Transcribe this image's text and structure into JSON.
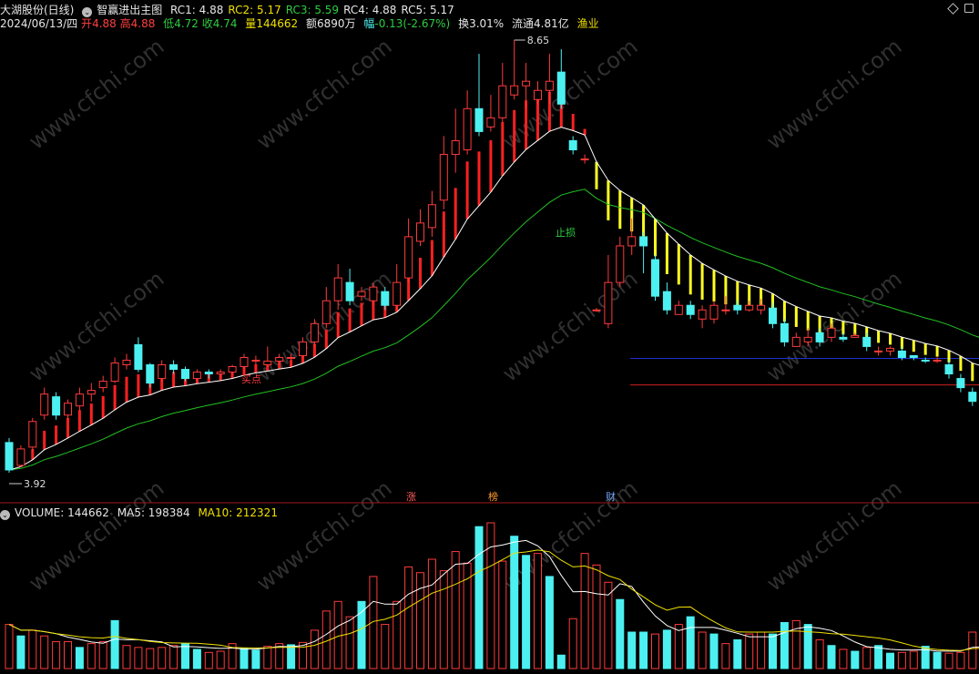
{
  "header": {
    "title": "大湖股份(日线)",
    "indicator_name": "智赢进出主图",
    "rc": [
      {
        "label": "RC1: 4.88",
        "color": "#e6e6e6"
      },
      {
        "label": "RC2: 5.17",
        "color": "#f0e000"
      },
      {
        "label": "RC3: 5.59",
        "color": "#2ecc40"
      },
      {
        "label": "RC4: 4.88",
        "color": "#e6e6e6"
      },
      {
        "label": "RC5: 5.17",
        "color": "#e6e6e6"
      }
    ]
  },
  "quote": {
    "date": "2024/06/13/四",
    "open_label": "开",
    "open": "4.88",
    "high_label": "高",
    "high": "4.88",
    "low_label": "低",
    "low": "4.72",
    "close_label": "收",
    "close": "4.74",
    "volume_label": "量",
    "volume": "144662",
    "amount_label": "额",
    "amount": "6890万",
    "change_label": "幅",
    "change": "-0.13(-2.67%)",
    "turnover": "换3.01%",
    "float_cap": "流通4.81亿",
    "sector": "渔业"
  },
  "volume_header": {
    "volume": "VOLUME: 144662",
    "ma5": "MA5: 198384",
    "ma10": "MA10: 212321"
  },
  "markers": {
    "zhang": "涨",
    "bang": "榜",
    "cai": "财",
    "buy": "买点",
    "stop": "止损",
    "high_label": "8.65",
    "low_label": "3.92"
  },
  "watermark": "www.cfchi.com",
  "colors": {
    "up": "#ff3a3a",
    "down": "#4cf0f0",
    "band_up": "#ff2020",
    "band_down": "#ffff20",
    "ma_long": "#22c022",
    "ma_white": "#ffffff",
    "vol_ma10": "#f0e000",
    "level_blue": "#2030d0",
    "level_red": "#d02020"
  },
  "chart_data": {
    "type": "candlestick",
    "price_range": [
      3.92,
      8.65
    ],
    "levels": [
      5.17,
      4.88
    ],
    "candles": [
      [
        4.25,
        3.95,
        4.3,
        3.92
      ],
      [
        4.0,
        4.18,
        4.22,
        3.98
      ],
      [
        4.2,
        4.48,
        4.52,
        4.15
      ],
      [
        4.55,
        4.78,
        4.85,
        4.5
      ],
      [
        4.75,
        4.55,
        4.8,
        4.5
      ],
      [
        4.55,
        4.68,
        4.72,
        4.5
      ],
      [
        4.65,
        4.78,
        4.85,
        4.6
      ],
      [
        4.78,
        4.82,
        4.9,
        4.7
      ],
      [
        4.85,
        4.92,
        4.98,
        4.8
      ],
      [
        4.92,
        5.12,
        5.18,
        4.9
      ],
      [
        5.1,
        5.15,
        5.22,
        5.05
      ],
      [
        5.32,
        5.05,
        5.4,
        5.02
      ],
      [
        5.1,
        4.9,
        5.12,
        4.85
      ],
      [
        4.95,
        5.1,
        5.15,
        4.92
      ],
      [
        5.1,
        5.05,
        5.15,
        5.0
      ],
      [
        5.05,
        4.95,
        5.08,
        4.92
      ],
      [
        4.95,
        5.02,
        5.05,
        4.92
      ],
      [
        5.02,
        5.0,
        5.05,
        4.95
      ],
      [
        5.0,
        5.02,
        5.05,
        4.95
      ],
      [
        5.02,
        5.08,
        5.1,
        5.0
      ],
      [
        5.08,
        5.18,
        5.22,
        5.05
      ],
      [
        5.15,
        5.15,
        5.2,
        5.1
      ],
      [
        5.1,
        5.14,
        5.3,
        5.08
      ],
      [
        5.14,
        5.18,
        5.22,
        5.1
      ],
      [
        5.18,
        5.18,
        5.22,
        5.15
      ],
      [
        5.2,
        5.35,
        5.4,
        5.18
      ],
      [
        5.35,
        5.55,
        5.6,
        5.3
      ],
      [
        5.55,
        5.8,
        5.95,
        5.5
      ],
      [
        5.8,
        6.05,
        6.2,
        5.7
      ],
      [
        6.0,
        5.8,
        6.15,
        5.75
      ],
      [
        5.85,
        5.9,
        5.95,
        5.8
      ],
      [
        5.8,
        5.95,
        6.0,
        5.75
      ],
      [
        5.9,
        5.75,
        5.95,
        5.7
      ],
      [
        5.75,
        6.0,
        6.2,
        5.7
      ],
      [
        6.05,
        6.5,
        6.7,
        6.0
      ],
      [
        6.45,
        6.65,
        6.8,
        6.4
      ],
      [
        6.6,
        6.85,
        7.0,
        6.5
      ],
      [
        6.9,
        7.4,
        7.6,
        6.8
      ],
      [
        7.4,
        7.55,
        7.9,
        7.2
      ],
      [
        7.45,
        7.9,
        8.1,
        7.4
      ],
      [
        7.9,
        7.65,
        8.5,
        7.6
      ],
      [
        7.7,
        7.8,
        8.05,
        7.65
      ],
      [
        7.8,
        8.15,
        8.4,
        7.75
      ],
      [
        8.05,
        8.15,
        8.65,
        8.0
      ],
      [
        8.15,
        8.2,
        8.4,
        7.9
      ],
      [
        8.0,
        8.1,
        8.2,
        7.95
      ],
      [
        8.1,
        8.2,
        8.5,
        7.95
      ],
      [
        8.3,
        7.95,
        8.55,
        7.9
      ],
      [
        7.55,
        7.45,
        7.6,
        7.4
      ],
      [
        7.35,
        7.35,
        7.4,
        7.3
      ],
      [
        5.7,
        5.7,
        5.72,
        5.68
      ],
      [
        5.55,
        6.0,
        6.3,
        5.5
      ],
      [
        6.0,
        6.4,
        6.5,
        5.95
      ],
      [
        6.4,
        6.5,
        6.7,
        6.3
      ],
      [
        6.5,
        6.4,
        6.55,
        6.1
      ],
      [
        6.25,
        5.85,
        6.3,
        5.8
      ],
      [
        5.9,
        5.7,
        6.0,
        5.65
      ],
      [
        5.65,
        5.75,
        5.8,
        5.65
      ],
      [
        5.75,
        5.65,
        5.8,
        5.6
      ],
      [
        5.6,
        5.7,
        5.75,
        5.5
      ],
      [
        5.6,
        5.75,
        5.8,
        5.55
      ],
      [
        5.7,
        5.7,
        5.85,
        5.65
      ],
      [
        5.75,
        5.7,
        5.8,
        5.65
      ],
      [
        5.7,
        5.75,
        5.8,
        5.68
      ],
      [
        5.7,
        5.75,
        5.82,
        5.65
      ],
      [
        5.72,
        5.55,
        5.78,
        5.5
      ],
      [
        5.55,
        5.35,
        5.6,
        5.3
      ],
      [
        5.3,
        5.4,
        5.45,
        5.3
      ],
      [
        5.35,
        5.4,
        5.5,
        5.3
      ],
      [
        5.45,
        5.35,
        5.5,
        5.3
      ],
      [
        5.4,
        5.5,
        5.55,
        5.35
      ],
      [
        5.4,
        5.38,
        5.45,
        5.35
      ],
      [
        5.4,
        5.42,
        5.45,
        5.4
      ],
      [
        5.4,
        5.3,
        5.45,
        5.25
      ],
      [
        5.25,
        5.25,
        5.3,
        5.2
      ],
      [
        5.25,
        5.28,
        5.3,
        5.2
      ],
      [
        5.25,
        5.18,
        5.3,
        5.15
      ],
      [
        5.2,
        5.18,
        5.2,
        5.15
      ],
      [
        5.15,
        5.14,
        5.18,
        5.12
      ],
      [
        5.15,
        5.15,
        5.18,
        5.12
      ],
      [
        5.1,
        5.0,
        5.15,
        4.95
      ],
      [
        4.95,
        4.85,
        5.0,
        4.8
      ],
      [
        4.8,
        4.7,
        4.85,
        4.65
      ],
      [
        4.7,
        4.85,
        4.88,
        4.7
      ],
      [
        4.78,
        4.85,
        4.88,
        4.72
      ],
      [
        4.88,
        4.74,
        4.88,
        4.72
      ]
    ],
    "volumes": [
      [
        115000,
        1
      ],
      [
        85000,
        0
      ],
      [
        100000,
        1
      ],
      [
        85000,
        1
      ],
      [
        70000,
        1
      ],
      [
        70000,
        1
      ],
      [
        55000,
        0
      ],
      [
        65000,
        1
      ],
      [
        70000,
        1
      ],
      [
        125000,
        0
      ],
      [
        60000,
        1
      ],
      [
        55000,
        1
      ],
      [
        52000,
        1
      ],
      [
        55000,
        1
      ],
      [
        60000,
        1
      ],
      [
        65000,
        0
      ],
      [
        50000,
        0
      ],
      [
        42000,
        1
      ],
      [
        45000,
        1
      ],
      [
        65000,
        1
      ],
      [
        52000,
        0
      ],
      [
        48000,
        0
      ],
      [
        58000,
        1
      ],
      [
        65000,
        1
      ],
      [
        62000,
        0
      ],
      [
        68000,
        1
      ],
      [
        100000,
        1
      ],
      [
        150000,
        1
      ],
      [
        175000,
        1
      ],
      [
        135000,
        1
      ],
      [
        175000,
        0
      ],
      [
        240000,
        1
      ],
      [
        115000,
        1
      ],
      [
        175000,
        1
      ],
      [
        265000,
        1
      ],
      [
        250000,
        1
      ],
      [
        285000,
        1
      ],
      [
        255000,
        1
      ],
      [
        305000,
        1
      ],
      [
        275000,
        1
      ],
      [
        370000,
        0
      ],
      [
        380000,
        1
      ],
      [
        280000,
        1
      ],
      [
        345000,
        0
      ],
      [
        295000,
        0
      ],
      [
        300000,
        1
      ],
      [
        240000,
        0
      ],
      [
        35000,
        0
      ],
      [
        130000,
        1
      ],
      [
        300000,
        1
      ],
      [
        270000,
        1
      ],
      [
        225000,
        1
      ],
      [
        180000,
        0
      ],
      [
        95000,
        0
      ],
      [
        95000,
        0
      ],
      [
        90000,
        1
      ],
      [
        100000,
        0
      ],
      [
        115000,
        1
      ],
      [
        135000,
        0
      ],
      [
        95000,
        1
      ],
      [
        90000,
        0
      ],
      [
        65000,
        1
      ],
      [
        75000,
        0
      ],
      [
        90000,
        1
      ],
      [
        95000,
        1
      ],
      [
        90000,
        0
      ],
      [
        120000,
        0
      ],
      [
        125000,
        1
      ],
      [
        115000,
        0
      ],
      [
        75000,
        1
      ],
      [
        60000,
        0
      ],
      [
        50000,
        1
      ],
      [
        45000,
        0
      ],
      [
        55000,
        1
      ],
      [
        60000,
        0
      ],
      [
        40000,
        0
      ],
      [
        42000,
        1
      ],
      [
        45000,
        1
      ],
      [
        58000,
        0
      ],
      [
        42000,
        0
      ],
      [
        40000,
        1
      ],
      [
        42000,
        1
      ],
      [
        95000,
        1
      ],
      [
        65000,
        0
      ],
      [
        70000,
        0
      ],
      [
        105000,
        1
      ],
      [
        85000,
        0
      ],
      [
        55000,
        0
      ],
      [
        60000,
        1
      ],
      [
        50000,
        0
      ]
    ],
    "title": "大湖股份(日线)"
  }
}
